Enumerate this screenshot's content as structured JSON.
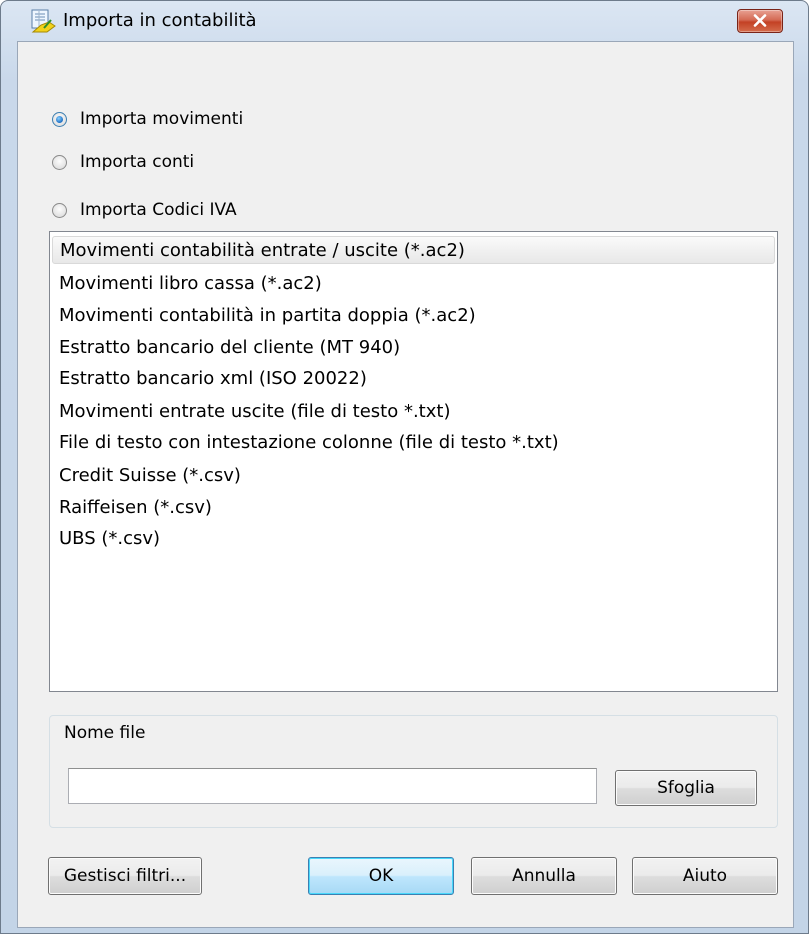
{
  "window": {
    "title": "Importa in contabilità",
    "icon": "import-accounting-icon",
    "close_icon": "close-icon"
  },
  "import_type": {
    "options": [
      {
        "label": "Importa movimenti",
        "checked": true
      },
      {
        "label": "Importa conti",
        "checked": false
      },
      {
        "label": "Importa Codici IVA",
        "checked": false
      }
    ]
  },
  "formats": {
    "selected_index": 0,
    "items": [
      "Movimenti contabilità entrate / uscite (*.ac2)",
      "Movimenti libro cassa (*.ac2)",
      "Movimenti contabilità in partita doppia (*.ac2)",
      "Estratto bancario del cliente (MT 940)",
      "Estratto bancario xml (ISO 20022)",
      "Movimenti entrate uscite (file di testo *.txt)",
      "File di testo con intestazione colonne (file di testo *.txt)",
      "Credit Suisse (*.csv)",
      "Raiffeisen (*.csv)",
      "UBS (*.csv)"
    ]
  },
  "file": {
    "group_label": "Nome file",
    "value": "",
    "browse_label": "Sfoglia"
  },
  "buttons": {
    "manage_filters": "Gestisci filtri...",
    "ok": "OK",
    "cancel": "Annulla",
    "help": "Aiuto"
  },
  "colors": {
    "selection_border": "#d9d9d9",
    "default_button_border": "#3c7fb1",
    "close_button": "#c34125"
  }
}
